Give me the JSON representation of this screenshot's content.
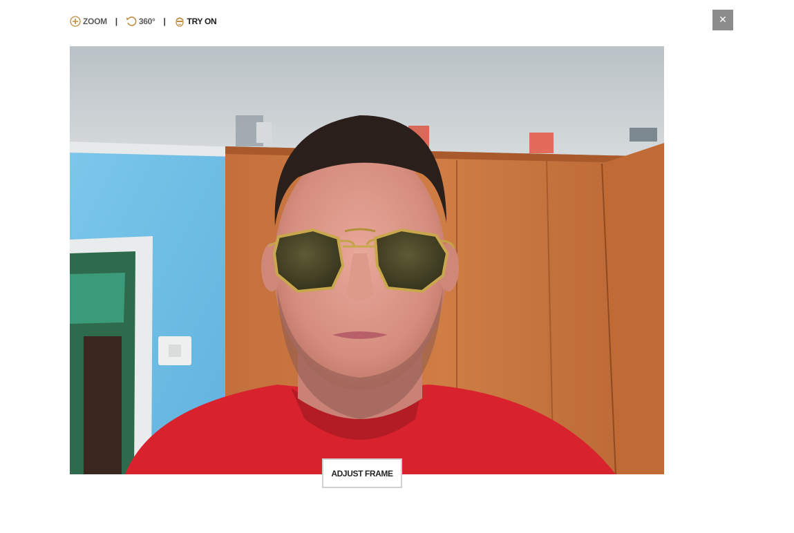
{
  "toolbar": {
    "zoom_label": "ZOOM",
    "rotate_label": "360°",
    "tryon_label": "TRY ON",
    "separator": "|"
  },
  "close_symbol": "✕",
  "adjust_label": "ADJUST FRAME",
  "icons": {
    "zoom": "plus-circle-icon",
    "rotate": "rotate-icon",
    "tryon": "face-icon",
    "close": "close-icon"
  },
  "colors": {
    "accent": "#c08a3e",
    "close_bg": "#8c8c8c",
    "button_border": "#d0d0d0"
  }
}
